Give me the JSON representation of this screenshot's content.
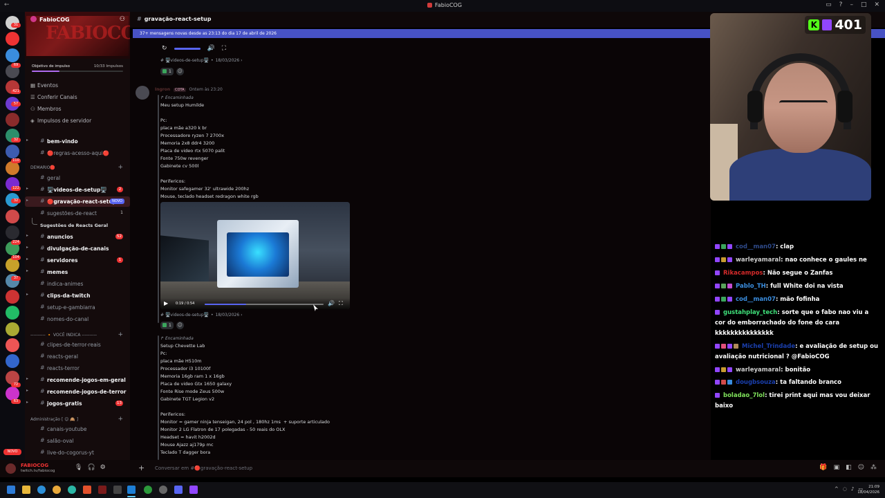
{
  "window": {
    "title": "FabioCOG"
  },
  "server": {
    "name": "FabioCOG",
    "banner_text": "FABIOCOG",
    "boost": {
      "label": "Objetivo de impulso",
      "progress": "10/33 Impulsos",
      "fraction": 0.3
    },
    "nav": [
      {
        "label": "Eventos",
        "icon": "calendar-icon"
      },
      {
        "label": "Conferir Canais",
        "icon": "list-icon"
      },
      {
        "label": "Membros",
        "icon": "members-icon"
      },
      {
        "label": "Impulsos de servidor",
        "icon": "boost-icon"
      }
    ]
  },
  "server_badges": [
    "31",
    "69",
    "421",
    "57",
    "32",
    "110",
    "122",
    "32",
    "224",
    "104",
    "37",
    "72",
    "63",
    "NOVO"
  ],
  "categories": {
    "demario": "DEMARIO🛑",
    "voce_indica": "---------- 🔸 VOCÊ INDICA ----------",
    "administracao": "Administração [ 😊 🙈 ]"
  },
  "channels": [
    {
      "label": "bem-vindo",
      "unread": true
    },
    {
      "label": "🔴regras-acesso-aqui🔴",
      "unread": false
    },
    {
      "label": "geral",
      "unread": false
    },
    {
      "label": "🖥️videos-de-setup🖥️",
      "unread": true,
      "badge": "2"
    },
    {
      "label": "🔴gravação-react-setup",
      "unread": true,
      "tag": "NOVO",
      "active": true
    },
    {
      "label": "sugestões-de-react",
      "unread": false,
      "count": "1"
    },
    {
      "label": "Sugestões de Reacts Geral",
      "unread": false,
      "thread": true
    },
    {
      "label": "anuncios",
      "unread": true,
      "badge": "52"
    },
    {
      "label": "divulgação-de-canais",
      "unread": true
    },
    {
      "label": "servidores",
      "unread": true,
      "badge": "1"
    },
    {
      "label": "memes",
      "unread": true
    },
    {
      "label": "indica-animes",
      "unread": false
    },
    {
      "label": "clips-da-twitch",
      "unread": true
    },
    {
      "label": "setup-e-gambiarra",
      "unread": false
    },
    {
      "label": "nomes-do-canal",
      "unread": false
    },
    {
      "label": "clipes-de-terror-reais",
      "unread": false
    },
    {
      "label": "reacts-geral",
      "unread": false
    },
    {
      "label": "reacts-terror",
      "unread": false
    },
    {
      "label": "recomende-jogos-em-geral",
      "unread": true
    },
    {
      "label": "recomende-jogos-de-terror",
      "unread": true
    },
    {
      "label": "jogos-gratis",
      "unread": true,
      "badge": "13"
    },
    {
      "label": "canais-youtube",
      "unread": false
    },
    {
      "label": "salão-oval",
      "unread": false
    },
    {
      "label": "live-do-cogorus-yt",
      "unread": false
    }
  ],
  "user": {
    "name": "FABIOCOG",
    "status": "twitch.tv/fabiocog"
  },
  "chat": {
    "channel_title": "gravação-react-setup",
    "new_messages_banner": "37+ mensagens novas desde as 23:13 do dia 17 de abril de 2026",
    "composer_placeholder": "Conversar em #🔴gravação-react-setup",
    "messages": [
      {
        "link": {
          "channel": "🖥️videos-de-setup🖥️",
          "date": "18/03/2026"
        },
        "reaction_count": "1"
      },
      {
        "author": "Ingron",
        "role_tag": "COTA",
        "time": "Ontem às 23:20",
        "forwarded": "Encaminhada",
        "body": "Meu setup Humilde\n\nPc:\nplaca mãe a320 k br\nProcessadore ryzen 7 2700x\nMemoria 2x8 ddr4 3200\nPlaca de video rtx 5070 palit\nFonte 750w revenger\nGabinete cv 500l\n\nPerifericos:\nMonitor safegamer 32' ultrawide 200hz\nMouse, teclado headset redragon white rgb",
        "video": {
          "time": "0:19 / 0:54",
          "progress": 0.35
        },
        "link": {
          "channel": "🖥️videos-de-setup🖥️",
          "date": "18/03/2026"
        },
        "reaction_count": "1"
      },
      {
        "forwarded": "Encaminhada",
        "body": "Setup Chevette Lab\nPc:\nplaca mãe H510m\nProcessador i3 10100f\nMemoria 16gb ram 1 x 16gb\nPlaca de video Gtx 1650 galaxy\nFonte Rise mode Zeus 500w\nGabinete TGT Legion v2\n\nPerifericos:\nMonitor = gamer ninja tenseigan, 24 pol , 180hz 1ms  + suporte articulado\nMonitor 2 LG Flatron de 17 polegadas - 50 reais do OLX\nHeadset = havit h2002d\nMouse Ajazz aj179p mc\nTeclado T dagger bora"
      }
    ]
  },
  "stream": {
    "viewer_count": "401"
  },
  "twitch_chat": [
    {
      "nick": "cod__man07",
      "color": "#2e4a8a",
      "text": ": clap",
      "badges": [
        "#9146ff",
        "#3ba55c",
        "#9146ff"
      ]
    },
    {
      "nick": "warleyamaral",
      "color": "#cfcfcf",
      "text": ": nao conhece o gaules ne",
      "badges": [
        "#9146ff",
        "#c79b2f",
        "#9146ff"
      ]
    },
    {
      "nick": "Rikacampos",
      "color": "#d42a2a",
      "text": ": Não segue o Zanfas",
      "badges": [
        "#9146ff"
      ]
    },
    {
      "nick": "Pablo_TH",
      "color": "#3a8dde",
      "text": ": full White doi na vista",
      "badges": [
        "#9146ff",
        "#5aa35a",
        "#c44dd1"
      ]
    },
    {
      "nick": "cod__man07",
      "color": "#3a8dde",
      "text": ": mão fofinha",
      "badges": [
        "#9146ff",
        "#3ba55c",
        "#9146ff"
      ]
    },
    {
      "nick": "gustahplay_tech",
      "color": "#3fe07a",
      "text": ": sorte que o fabo nao viu a cor do emborrachado do fone do cara kkkkkkkkkkkkkkk",
      "badges": [
        "#9146ff"
      ]
    },
    {
      "nick": "Michel_Trindade",
      "color": "#1a3fae",
      "text": ": e avaliação de setup ou avaliação nutricional ? @FabioCOG",
      "badges": [
        "#9146ff",
        "#e0507a",
        "#9146ff",
        "#b08a5a"
      ]
    },
    {
      "nick": "warleyamaral",
      "color": "#cfcfcf",
      "text": ": bonitão",
      "badges": [
        "#9146ff",
        "#c79b2f",
        "#9146ff"
      ]
    },
    {
      "nick": "dougbsouza",
      "color": "#1a3fae",
      "text": ": ta faltando branco",
      "badges": [
        "#9146ff",
        "#d14a4a",
        "#3a8dde"
      ]
    },
    {
      "nick": "boladao_7lol",
      "color": "#7ee05a",
      "text": ": tirei print aqui mas vou deixar baixo",
      "badges": [
        "#9146ff"
      ]
    }
  ],
  "taskbar": {
    "time": "21:09",
    "date": "18/04/2026"
  },
  "colors": {
    "accent": "#5865f2",
    "brand_red": "#e33333",
    "kick_green": "#53fc18",
    "twitch_purple": "#9146ff"
  }
}
